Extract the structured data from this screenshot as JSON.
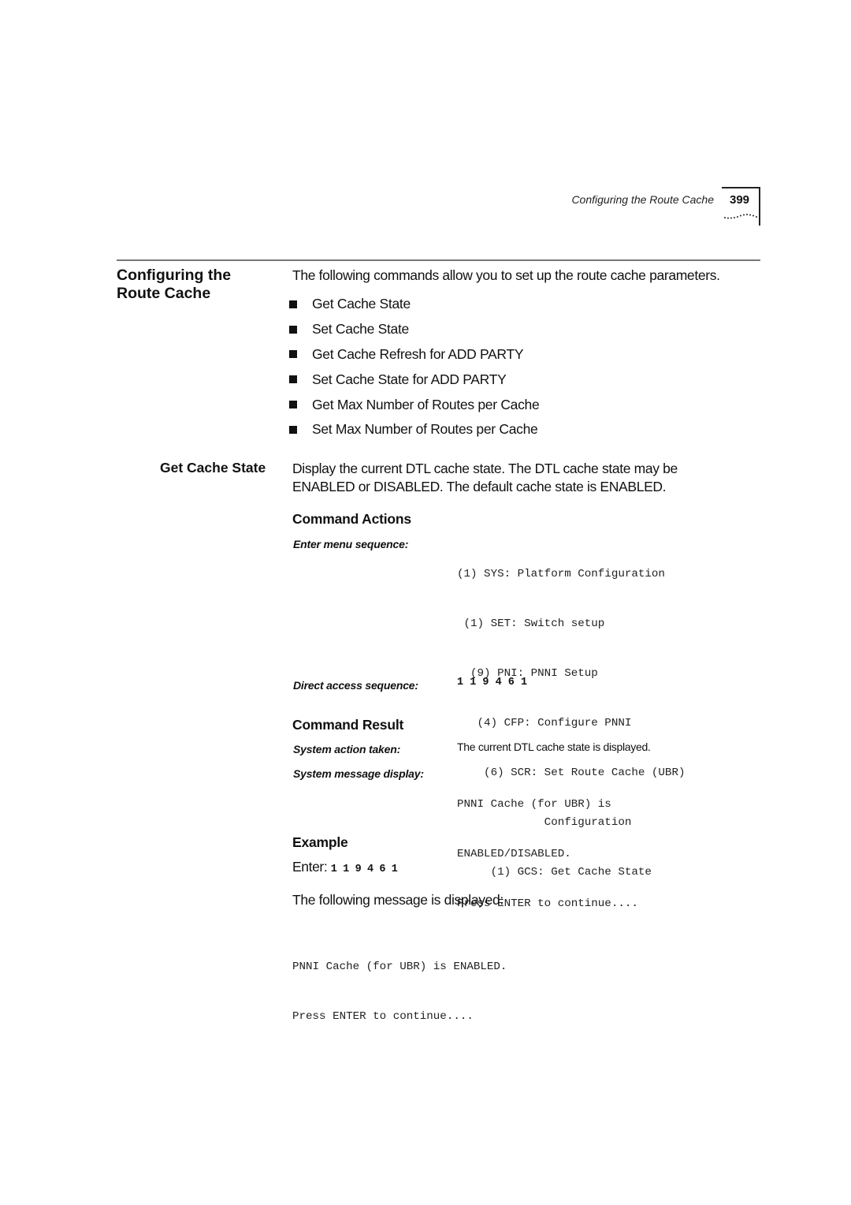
{
  "header": {
    "running_title": "Configuring the Route Cache",
    "page_number": "399"
  },
  "section": {
    "title_line1": "Configuring the",
    "title_line2": "Route Cache",
    "intro": "The following commands allow you to set up the route cache parameters.",
    "bullets": [
      "Get Cache State",
      "Set Cache State",
      "Get Cache Refresh for ADD PARTY",
      "Set Cache State for ADD PARTY",
      "Get Max Number of Routes per Cache",
      "Set Max Number of Routes per Cache"
    ]
  },
  "subsection": {
    "title": "Get Cache State",
    "description_line1": "Display the current DTL cache state. The DTL cache state may be",
    "description_line2": "ENABLED or DISABLED. The default cache state is ENABLED.",
    "command_actions": {
      "heading": "Command Actions",
      "menu_label": "Enter menu sequence:",
      "menu_lines": [
        "(1) SYS: Platform Configuration",
        " (1) SET: Switch setup",
        "  (9) PNI: PNNI Setup",
        "   (4) CFP: Configure PNNI",
        "    (6) SCR: Set Route Cache (UBR)",
        "             Configuration",
        "     (1) GCS: Get Cache State"
      ],
      "direct_label": "Direct access sequence:",
      "direct_value": "1 1 9 4 6 1"
    },
    "command_result": {
      "heading": "Command Result",
      "action_label": "System action taken:",
      "action_value": "The current DTL cache state is displayed.",
      "message_label": "System message display:",
      "message_lines": [
        "PNNI Cache (for UBR) is",
        "ENABLED/DISABLED.",
        "Press ENTER to continue...."
      ]
    },
    "example": {
      "heading": "Example",
      "enter_label": "Enter:",
      "enter_value": "1 1 9 4 6 1",
      "following": "The following message is displayed:",
      "output_lines": [
        "PNNI Cache (for UBR) is ENABLED.",
        "Press ENTER to continue...."
      ]
    }
  }
}
